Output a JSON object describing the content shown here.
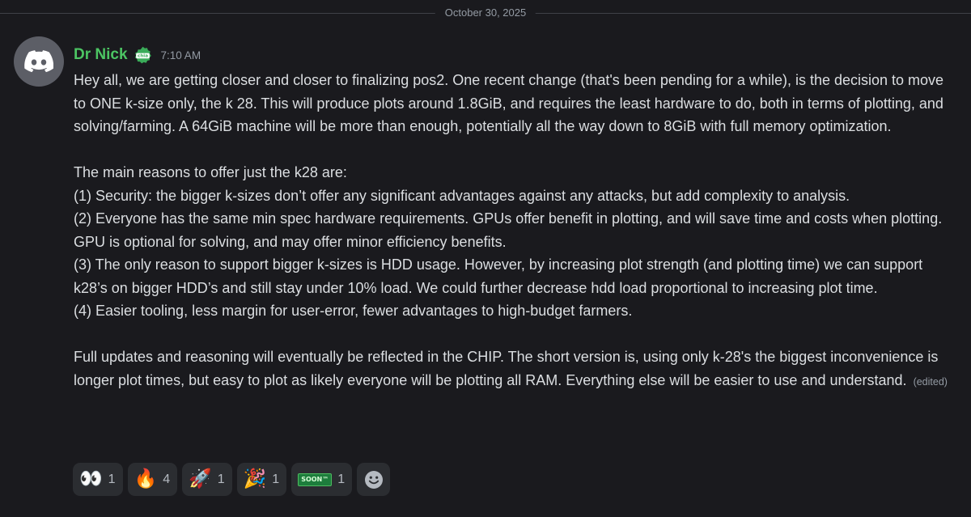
{
  "date_divider": "October 30, 2025",
  "message": {
    "author": "Dr Nick",
    "badge": "chia",
    "timestamp": "7:10 AM",
    "paragraphs": [
      "Hey all, we are getting closer and closer to finalizing pos2. One recent change (that's been pending for a while), is the decision to move to ONE k-size only, the k 28. This will produce plots around 1.8GiB, and requires the least hardware to do, both in terms of plotting, and solving/farming. A 64GiB machine will be more than enough, potentially all the way down to 8GiB with full memory optimization.",
      "The main reasons to offer just the k28 are:",
      "(1) Security: the bigger k-sizes don’t offer any significant advantages against any attacks, but add complexity to analysis.",
      "(2) Everyone has the same min spec hardware requirements. GPUs offer benefit in plotting, and will save time and costs when plotting. GPU is optional for solving, and may offer minor efficiency benefits.",
      "(3) The only reason to support bigger k-sizes is HDD usage. However, by increasing plot strength (and plotting time) we can support k28’s on bigger HDD’s and still stay under 10% load.  We could further decrease hdd load proportional to increasing plot time.",
      "(4) Easier tooling, less margin for user-error, fewer advantages to high-budget farmers.",
      "Full updates and reasoning will eventually be reflected in the CHIP. The short version is, using only k-28's the biggest inconvenience is longer plot times, but easy to plot as likely everyone will be plotting all RAM. Everything else will be easier to use and understand."
    ],
    "edited_label": "(edited)"
  },
  "reactions": [
    {
      "icon": "eyes-emoji",
      "emoji": "👀",
      "count": "1"
    },
    {
      "icon": "fire-emoji",
      "emoji": "🔥",
      "count": "4"
    },
    {
      "icon": "rocket-emoji",
      "emoji": "🚀",
      "count": "1"
    },
    {
      "icon": "party-popper-emoji",
      "emoji": "🎉",
      "count": "1"
    },
    {
      "icon": "soon-emoji",
      "emoji": "SOON™",
      "count": "1"
    }
  ],
  "colors": {
    "background": "#1a1a1e",
    "username": "#4cc563",
    "text": "#dbdee1",
    "muted": "#949ba4",
    "reaction_bg": "#2b2d31"
  }
}
